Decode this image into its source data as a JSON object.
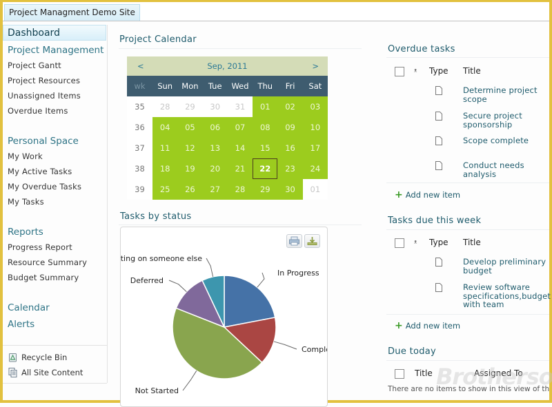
{
  "site": {
    "title": "Project Managment Demo Site"
  },
  "sidebar": {
    "dashboard": "Dashboard",
    "groups": [
      {
        "heading": "Project Management",
        "items": [
          "Project Gantt",
          "Project Resources",
          "Unassigned Items",
          "Overdue Items"
        ]
      },
      {
        "heading": "Personal Space",
        "items": [
          "My Work",
          "My Active Tasks",
          "My Overdue Tasks",
          "My Tasks"
        ]
      },
      {
        "heading": "Reports",
        "items": [
          "Progress Report",
          "Resource Summary",
          "Budget Summary"
        ]
      },
      {
        "heading": "Calendar",
        "items": []
      },
      {
        "heading": "Alerts",
        "items": []
      }
    ],
    "bottom": [
      {
        "label": "Recycle Bin",
        "icon": "recycle-bin-icon"
      },
      {
        "label": "All Site Content",
        "icon": "site-content-icon"
      }
    ]
  },
  "calendar": {
    "section_title": "Project Calendar",
    "month_label": "Sep, 2011",
    "prev": "<",
    "next": ">",
    "week_header": "wk",
    "days": [
      "Sun",
      "Mon",
      "Tue",
      "Wed",
      "Thu",
      "Fri",
      "Sat"
    ],
    "today": "22",
    "colors": {
      "project": "#9ccc1e",
      "header": "#3e5c6f",
      "nav": "#d4dcb7"
    },
    "weeks": [
      {
        "wk": "35",
        "cells": [
          {
            "d": "28",
            "t": "other"
          },
          {
            "d": "29",
            "t": "other"
          },
          {
            "d": "30",
            "t": "other"
          },
          {
            "d": "31",
            "t": "other"
          },
          {
            "d": "01",
            "t": "proj"
          },
          {
            "d": "02",
            "t": "proj"
          },
          {
            "d": "03",
            "t": "proj"
          }
        ]
      },
      {
        "wk": "36",
        "cells": [
          {
            "d": "04",
            "t": "proj"
          },
          {
            "d": "05",
            "t": "proj"
          },
          {
            "d": "06",
            "t": "proj"
          },
          {
            "d": "07",
            "t": "proj"
          },
          {
            "d": "08",
            "t": "proj"
          },
          {
            "d": "09",
            "t": "proj"
          },
          {
            "d": "10",
            "t": "proj"
          }
        ]
      },
      {
        "wk": "37",
        "cells": [
          {
            "d": "11",
            "t": "proj"
          },
          {
            "d": "12",
            "t": "proj"
          },
          {
            "d": "13",
            "t": "proj"
          },
          {
            "d": "14",
            "t": "proj"
          },
          {
            "d": "15",
            "t": "proj"
          },
          {
            "d": "16",
            "t": "proj"
          },
          {
            "d": "17",
            "t": "proj"
          }
        ]
      },
      {
        "wk": "38",
        "cells": [
          {
            "d": "18",
            "t": "proj"
          },
          {
            "d": "19",
            "t": "proj"
          },
          {
            "d": "20",
            "t": "proj"
          },
          {
            "d": "21",
            "t": "proj"
          },
          {
            "d": "22",
            "t": "proj today"
          },
          {
            "d": "23",
            "t": "proj"
          },
          {
            "d": "24",
            "t": "proj"
          }
        ]
      },
      {
        "wk": "39",
        "cells": [
          {
            "d": "25",
            "t": "proj"
          },
          {
            "d": "26",
            "t": "proj"
          },
          {
            "d": "27",
            "t": "proj"
          },
          {
            "d": "28",
            "t": "proj"
          },
          {
            "d": "29",
            "t": "proj"
          },
          {
            "d": "30",
            "t": "proj"
          },
          {
            "d": "01",
            "t": "other"
          }
        ]
      }
    ]
  },
  "tasks_by_status": {
    "section_title": "Tasks by status",
    "buttons": [
      {
        "icon": "print-icon"
      },
      {
        "icon": "download-icon"
      }
    ]
  },
  "chart_data": {
    "type": "pie",
    "title": "Tasks by status",
    "start": "top",
    "direction": "clockwise",
    "slices": [
      {
        "label": "In Progress",
        "value": 22,
        "color": "#4572a7"
      },
      {
        "label": "Completed",
        "value": 15,
        "color": "#aa4643"
      },
      {
        "label": "Not Started",
        "value": 44,
        "color": "#89a54e"
      },
      {
        "label": "Deferred",
        "value": 12,
        "color": "#80699b"
      },
      {
        "label": "Waiting on someone else",
        "value": 7,
        "color": "#3d96ae"
      }
    ],
    "visible_labels": [
      "In Progress",
      "Comple",
      "Not Started",
      "Deferred",
      "iting on someone else"
    ]
  },
  "overdue": {
    "title": "Overdue tasks",
    "columns": [
      "Type",
      "Title"
    ],
    "rows": [
      {
        "title": "Determine project scope"
      },
      {
        "title": "Secure project sponsorship"
      },
      {
        "title": "Scope complete"
      },
      {
        "title": "Conduct needs analysis"
      }
    ],
    "add_label": "Add new item"
  },
  "this_week": {
    "title": "Tasks due this week",
    "columns": [
      "Type",
      "Title"
    ],
    "rows": [
      {
        "title": "Develop preliminary budget"
      },
      {
        "title": "Review software specifications,budget with team"
      }
    ],
    "add_label": "Add new item"
  },
  "due_today": {
    "title": "Due today",
    "columns": [
      "Title",
      "Assigned To"
    ],
    "empty_message": "There are no items to show in this view of the \"Ta"
  },
  "watermark": "Brothersoft"
}
